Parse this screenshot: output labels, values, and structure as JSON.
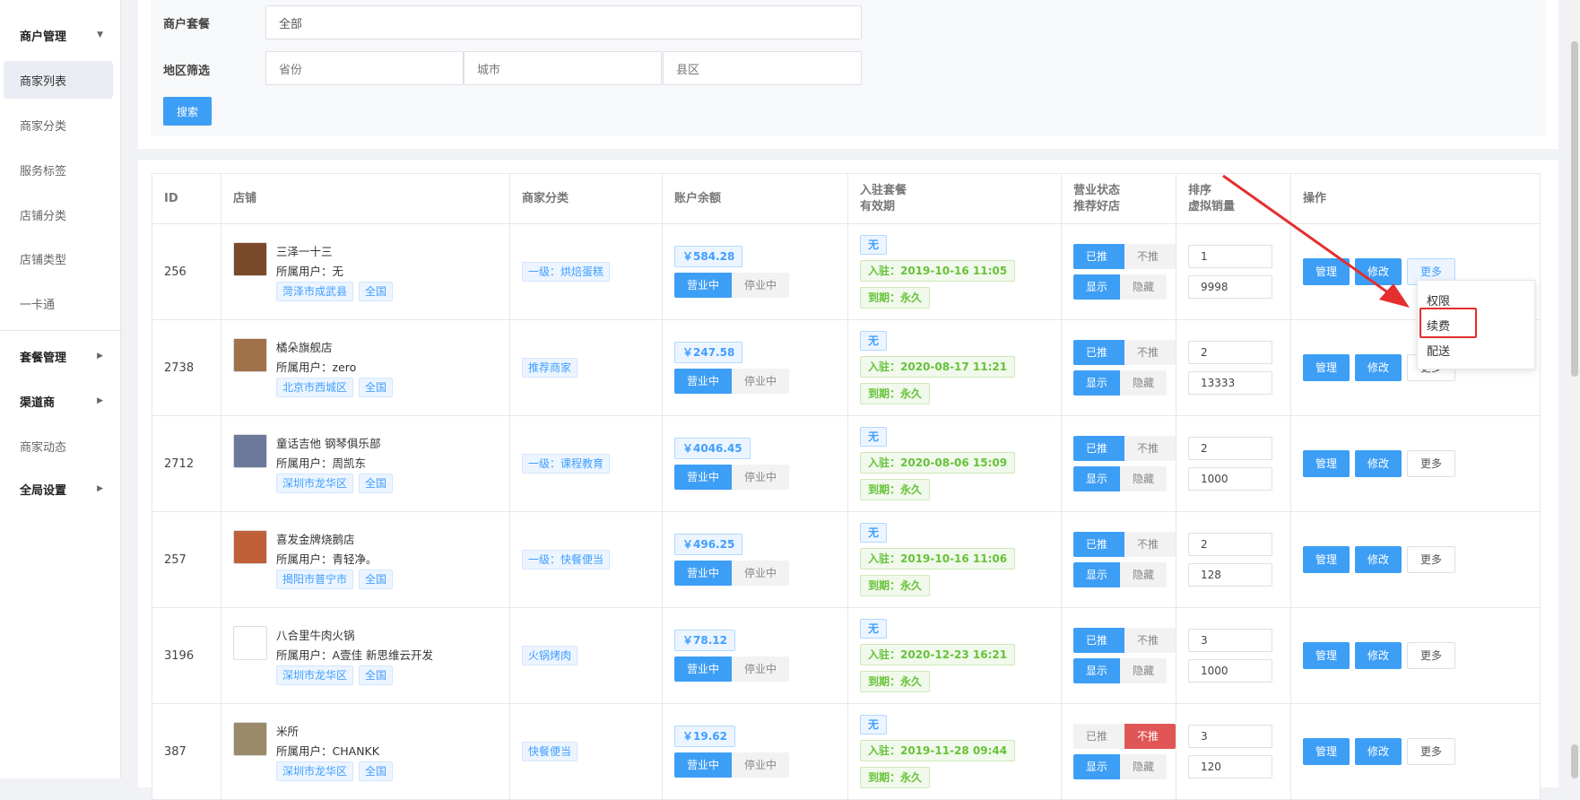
{
  "sidebar": {
    "groups": [
      "商户管理",
      "套餐管理",
      "渠道商",
      "全局设置"
    ],
    "items": [
      "商家列表",
      "商家分类",
      "服务标签",
      "店铺分类",
      "店铺类型",
      "一卡通",
      "商家动态"
    ]
  },
  "filter": {
    "package_label": "商户套餐",
    "package_value": "全部",
    "region_label": "地区筛选",
    "province_placeholder": "省份",
    "city_placeholder": "城市",
    "district_placeholder": "县区",
    "search_label": "搜索"
  },
  "table": {
    "headers": {
      "id": "ID",
      "shop": "店铺",
      "category": "商家分类",
      "balance": "账户余额",
      "package": "入驻套餐",
      "package2": "有效期",
      "status": "营业状态",
      "status2": "推荐好店",
      "sort": "排序",
      "sort2": "虚拟销量",
      "ops": "操作"
    },
    "labels": {
      "owner_prefix": "所属用户：",
      "open": "营业中",
      "closed": "停业中",
      "recommended": "已推荐",
      "not_recommended": "不推荐",
      "show": "显示",
      "hide": "隐藏",
      "manage": "管理",
      "edit": "修改",
      "more": "更多",
      "national": "全国"
    },
    "rows": [
      {
        "id": "256",
        "name": "三泽一十三",
        "owner": "无",
        "area": "菏泽市成武县",
        "category": "一级：烘焙蛋糕",
        "balance": "￥584.28",
        "package": "无",
        "join": "入驻：2019-10-16 11:05",
        "expire": "到期：永久",
        "rec_on": true,
        "sort": "1",
        "sales": "9998",
        "thumb": "#7a4a2a"
      },
      {
        "id": "2738",
        "name": "橘朵旗舰店",
        "owner": "zero",
        "area": "北京市西城区",
        "category": "推荐商家",
        "balance": "￥247.58",
        "package": "无",
        "join": "入驻：2020-08-17 11:21",
        "expire": "到期：永久",
        "rec_on": true,
        "sort": "2",
        "sales": "13333",
        "thumb": "#a0724a"
      },
      {
        "id": "2712",
        "name": "童话吉他 钢琴俱乐部",
        "owner": "周凯东",
        "area": "深圳市龙华区",
        "category": "一级：课程教育",
        "balance": "￥4046.45",
        "package": "无",
        "join": "入驻：2020-08-06 15:09",
        "expire": "到期：永久",
        "rec_on": true,
        "sort": "2",
        "sales": "1000",
        "thumb": "#6b7a9a"
      },
      {
        "id": "257",
        "name": "喜发金牌烧鹅店",
        "owner": "青轻净。",
        "area": "揭阳市普宁市",
        "category": "一级：快餐便当",
        "balance": "￥496.25",
        "package": "无",
        "join": "入驻：2019-10-16 11:06",
        "expire": "到期：永久",
        "rec_on": true,
        "sort": "2",
        "sales": "128",
        "thumb": "#c0603a"
      },
      {
        "id": "3196",
        "name": "八合里牛肉火锅",
        "owner": "A壹佳 新思维云开发",
        "area": "深圳市龙华区",
        "category": "火锅烤肉",
        "balance": "￥78.12",
        "package": "无",
        "join": "入驻：2020-12-23 16:21",
        "expire": "到期：永久",
        "rec_on": true,
        "sort": "3",
        "sales": "1000",
        "thumb": "#ffffff"
      },
      {
        "id": "387",
        "name": "米所",
        "owner": "CHANKK",
        "area": "深圳市龙华区",
        "category": "快餐便当",
        "balance": "￥19.62",
        "package": "无",
        "join": "入驻：2019-11-28 09:44",
        "expire": "到期：永久",
        "rec_on": false,
        "sort": "3",
        "sales": "120",
        "thumb": "#9a8a6a"
      }
    ]
  },
  "dropdown": {
    "items": [
      "权限",
      "续费",
      "配送"
    ]
  },
  "colors": {
    "primary": "#3d9ef5",
    "annotation": "#e52e2e"
  }
}
